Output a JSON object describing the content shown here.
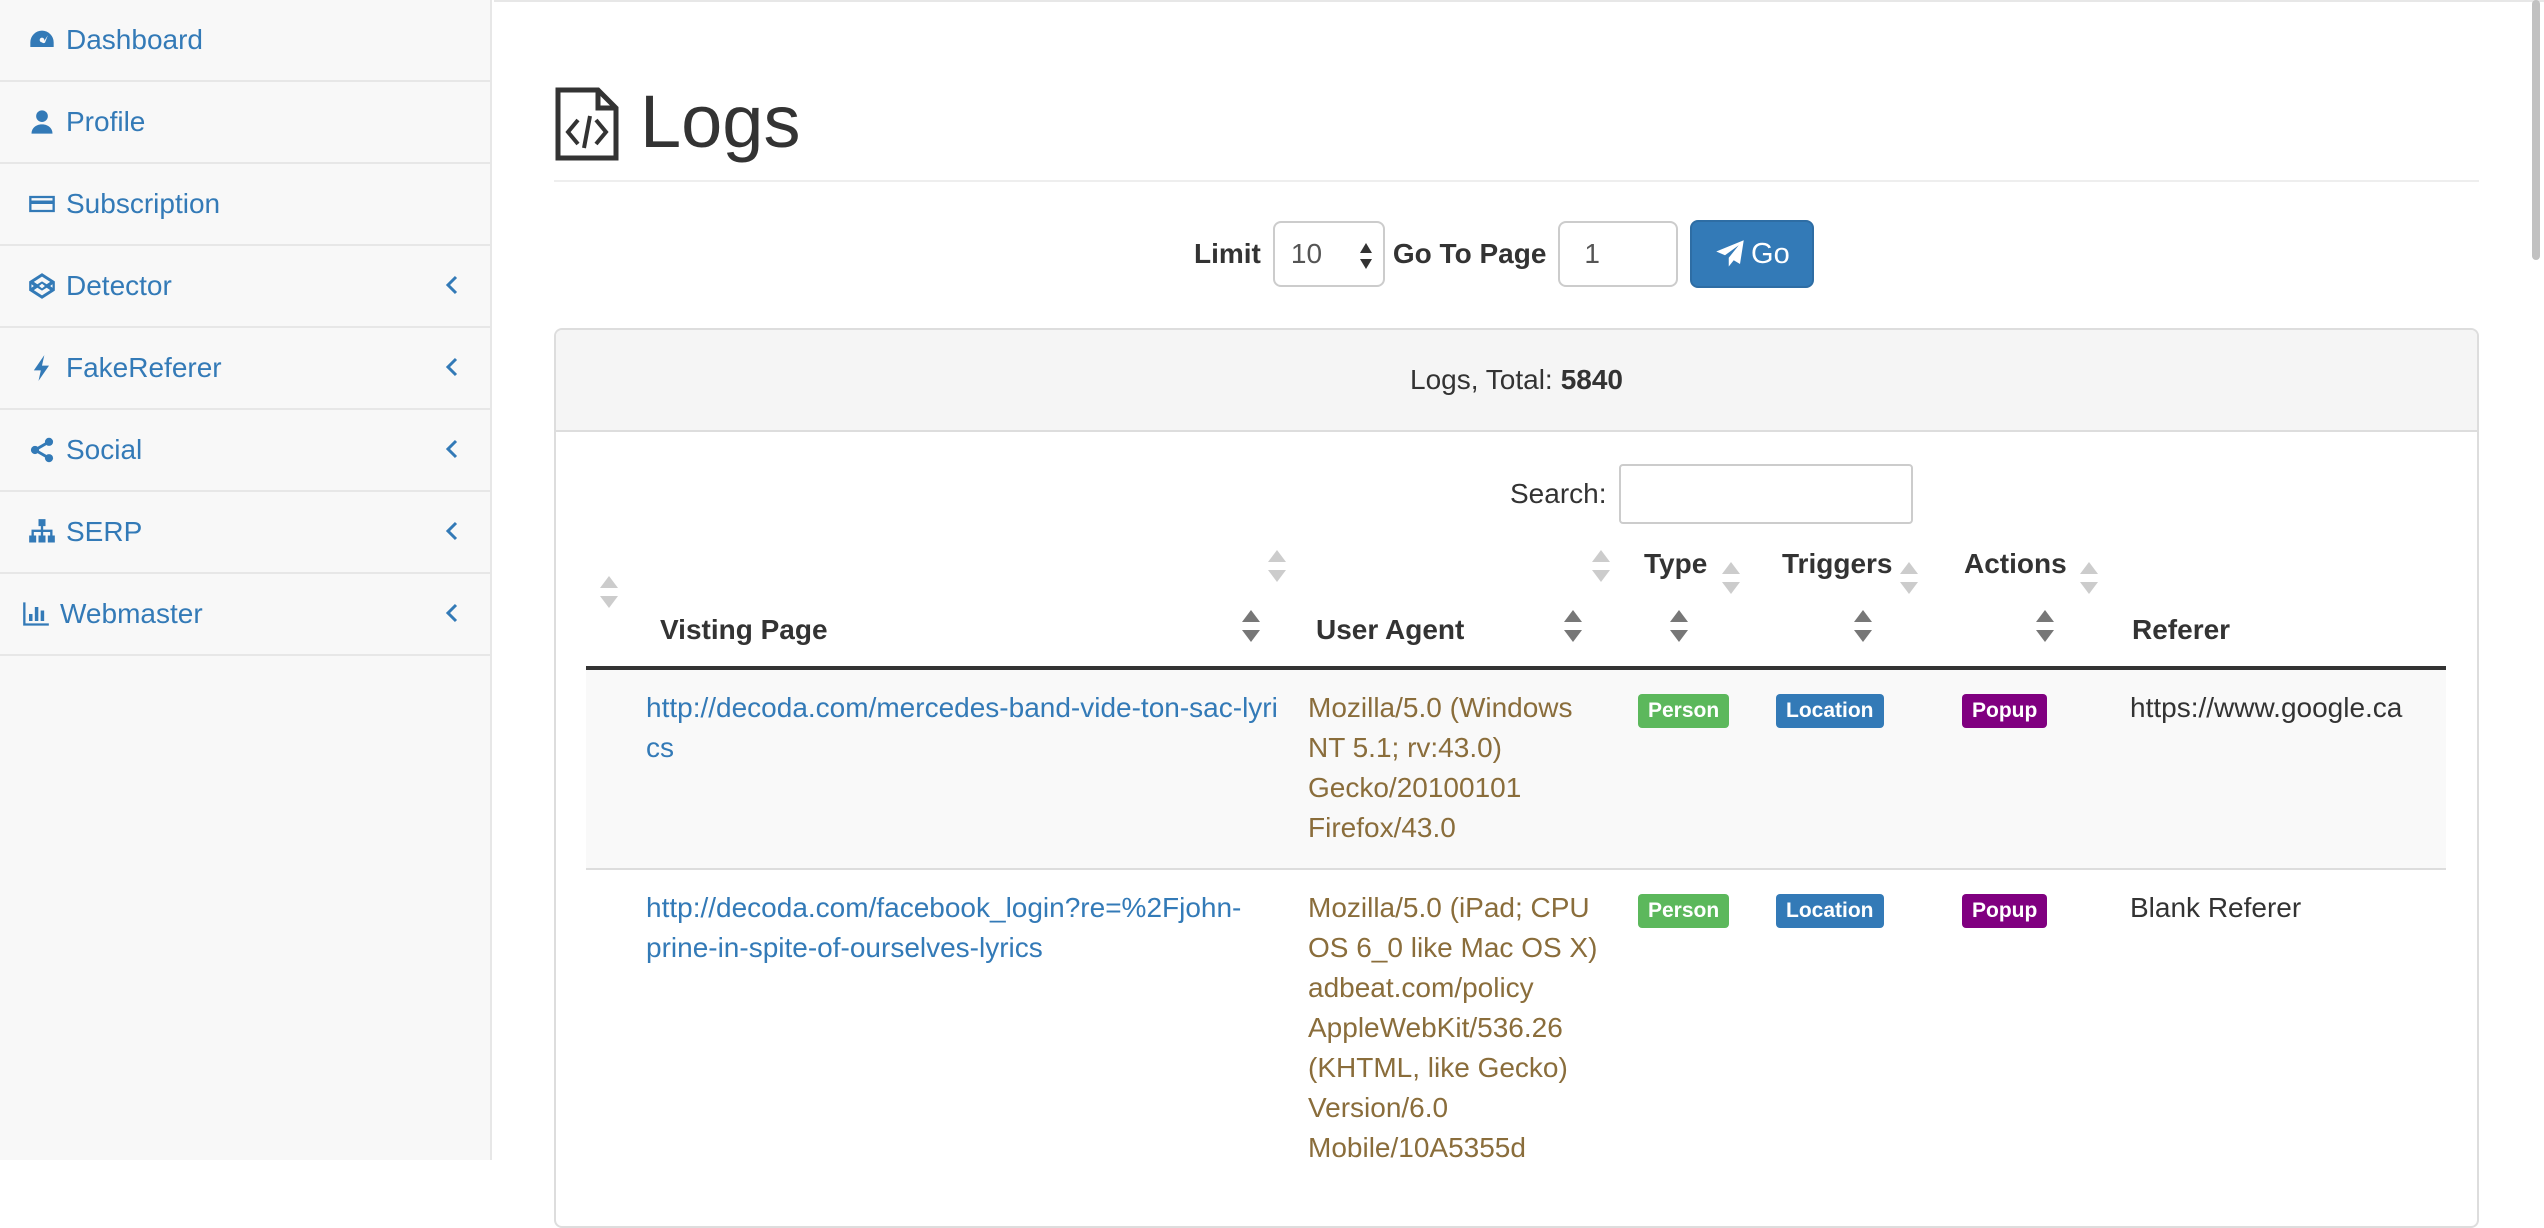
{
  "sidebar": {
    "items": [
      {
        "label": "Dashboard",
        "icon": "dashboard-icon",
        "has_chevron": false
      },
      {
        "label": "Profile",
        "icon": "user-icon",
        "has_chevron": false
      },
      {
        "label": "Subscription",
        "icon": "credit-card-icon",
        "has_chevron": false
      },
      {
        "label": "Detector",
        "icon": "codepen-icon",
        "has_chevron": true
      },
      {
        "label": "FakeReferer",
        "icon": "bolt-icon",
        "has_chevron": true
      },
      {
        "label": "Social",
        "icon": "share-icon",
        "has_chevron": true
      },
      {
        "label": "SERP",
        "icon": "sitemap-icon",
        "has_chevron": true
      },
      {
        "label": "Webmaster",
        "icon": "bar-chart-icon",
        "has_chevron": true
      }
    ]
  },
  "header": {
    "title": "Logs",
    "icon": "file-code-icon"
  },
  "controls": {
    "limit_label": "Limit",
    "limit_value": "10",
    "goto_label": "Go To Page",
    "page_value": "1",
    "go_label": "Go"
  },
  "panel": {
    "heading_prefix": "Logs, Total:",
    "total": "5840",
    "search_label": "Search:"
  },
  "table": {
    "columns": [
      "Visting Page",
      "User Agent",
      "Type",
      "Triggers",
      "Actions",
      "Referer"
    ],
    "rows": [
      {
        "page": "http://decoda.com/mercedes-band-vide-ton-sac-lyrics",
        "user_agent": "Mozilla/5.0 (Windows NT 5.1; rv:43.0) Gecko/20100101 Firefox/43.0",
        "type": "Person",
        "trigger": "Location",
        "action": "Popup",
        "referer": "https://www.google.ca"
      },
      {
        "page": "http://decoda.com/facebook_login?re=%2Fjohn-prine-in-spite-of-ourselves-lyrics",
        "user_agent": "Mozilla/5.0 (iPad; CPU OS 6_0 like Mac OS X) adbeat.com/policy AppleWebKit/536.26 (KHTML, like Gecko) Version/6.0 Mobile/10A5355d",
        "type": "Person",
        "trigger": "Location",
        "action": "Popup",
        "referer": "Blank Referer"
      }
    ]
  },
  "colors": {
    "link": "#337ab7",
    "user_agent": "#8a6d3b",
    "person": "#5cb85c",
    "location": "#337ab7",
    "popup": "#800080"
  }
}
